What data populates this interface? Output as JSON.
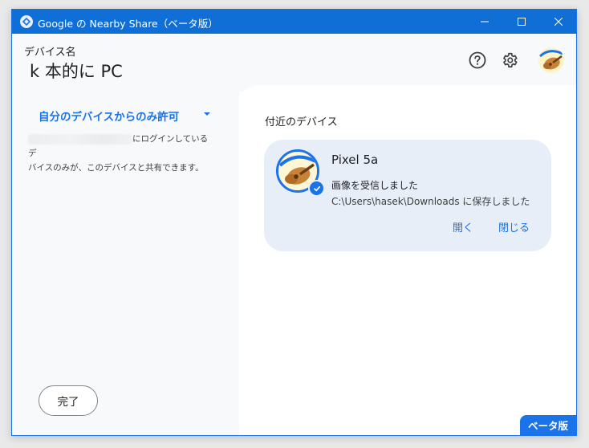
{
  "window": {
    "title": "Google の Nearby Share（ベータ版）",
    "controls": {
      "minimize_icon": "minimize-icon",
      "maximize_icon": "maximize-icon",
      "close_icon": "close-icon"
    }
  },
  "header": {
    "device_caption": "デバイス名",
    "device_name": "k 本的に PC",
    "help_icon": "help-icon",
    "settings_icon": "gear-icon",
    "avatar_icon": "avatar-guitar"
  },
  "sidebar": {
    "visibility_label": "自分のデバイスからのみ許可",
    "description_suffix": "にログインしているデ",
    "description_line2": "バイスのみが、このデバイスと共有できます。",
    "done_label": "完了"
  },
  "main": {
    "section_title": "付近のデバイス",
    "card": {
      "device_name": "Pixel 5a",
      "status": "画像を受信しました",
      "path": "C:\\Users\\hasek\\Downloads に保存しました",
      "open_label": "開く",
      "close_label": "閉じる"
    }
  },
  "beta_badge": "ベータ版",
  "colors": {
    "accent": "#1a73e8",
    "titlebar": "#0f6fd6",
    "card_bg": "#e8eef8",
    "panel_bg": "#f8f9fb"
  }
}
